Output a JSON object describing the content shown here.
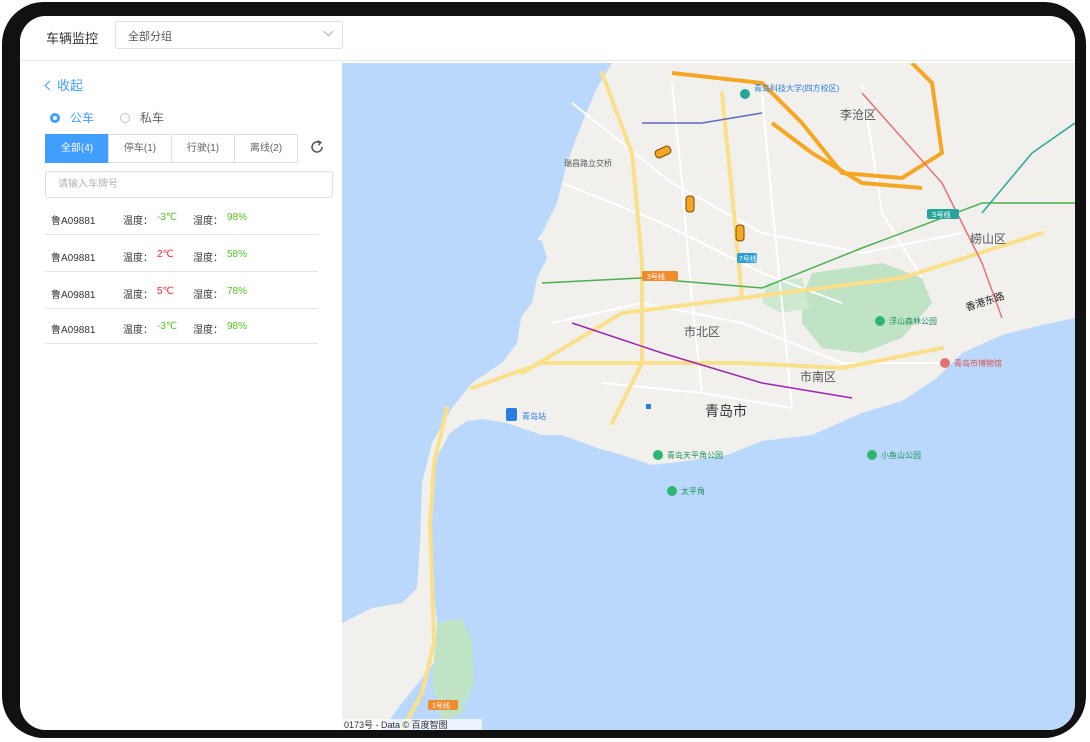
{
  "header": {
    "title": "车辆监控",
    "group_select": "全部分组"
  },
  "panel": {
    "collapse_label": "收起",
    "radio_public": "公车",
    "radio_private": "私车",
    "tabs": [
      {
        "label": "全部(4)",
        "active": true
      },
      {
        "label": "停车(1)",
        "active": false
      },
      {
        "label": "行驶(1)",
        "active": false
      },
      {
        "label": "离线(2)",
        "active": false
      }
    ],
    "search_placeholder": "请输入车牌号",
    "temp_label": "温度：",
    "humidity_label": "湿度：",
    "vehicles": [
      {
        "plate": "鲁A09881",
        "temp": "-3℃",
        "temp_color": "green",
        "humidity": "98%"
      },
      {
        "plate": "鲁A09881",
        "temp": "2℃",
        "temp_color": "red",
        "humidity": "58%"
      },
      {
        "plate": "鲁A09881",
        "temp": "5℃",
        "temp_color": "red",
        "humidity": "78%"
      },
      {
        "plate": "鲁A09881",
        "temp": "-3℃",
        "temp_color": "green",
        "humidity": "98%"
      }
    ]
  },
  "map": {
    "districts": [
      "李沧区",
      "崂山区",
      "市北区",
      "市南区",
      "青岛市"
    ],
    "pois": [
      "青岛科技大学(四方校区)",
      "浮山森林公园",
      "青岛市博物馆",
      "青岛天平角公园",
      "小鱼山公园",
      "太平角",
      "青岛站",
      "瑞昌路立交桥"
    ],
    "road_names": [
      "香港东路"
    ],
    "road_badges": [
      "S号线",
      "7号线",
      "3号线",
      "1号线"
    ],
    "copyright": "0173号 - Data © 百度智图",
    "colors": {
      "sea": "#b9d8fb",
      "land": "#f1f0ec",
      "park": "#bfe3c4",
      "road": "#fbe08c",
      "highway": "#f5a623",
      "accent": "#409eff"
    }
  }
}
